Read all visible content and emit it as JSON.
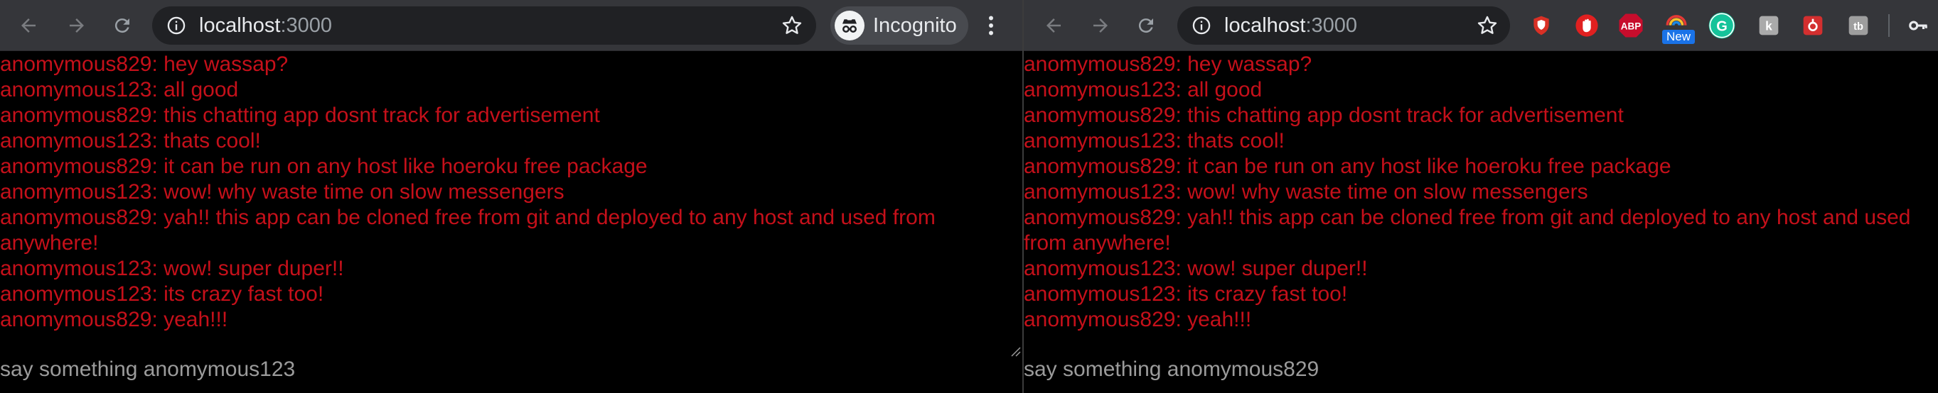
{
  "left_window": {
    "toolbar": {
      "url_host": "localhost",
      "url_port": ":3000",
      "profile_label": "Incognito"
    },
    "messages": [
      "anomymous829: hey wassap?",
      "anomymous123: all good",
      "anomymous829: this chatting app dosnt track for advertisement",
      "anomymous123: thats cool!",
      "anomymous829: it can be run on any host like hoeroku free package",
      "anomymous123: wow! why waste time on slow messengers",
      "anomymous829: yah!! this app can be cloned free from git and deployed to any host and used from anywhere!",
      "anomymous123: wow! super duper!!",
      "anomymous123: its crazy fast too!",
      "anomymous829: yeah!!!"
    ],
    "input_placeholder": "say something anomymous123"
  },
  "right_window": {
    "toolbar": {
      "url_host": "localhost",
      "url_port": ":3000",
      "extensions": [
        {
          "icon": "shield-extension-icon",
          "color": "#d93025"
        },
        {
          "icon": "stop-hand-extension-icon",
          "color": "#e02020"
        },
        {
          "icon": "adblock-plus-icon",
          "label": "ABP",
          "color": "#c70d2c"
        },
        {
          "icon": "rainbow-extension-icon",
          "badge": "New",
          "color": "#1a73e8"
        },
        {
          "icon": "grammarly-icon",
          "label": "G",
          "color": "#15c39a"
        },
        {
          "icon": "k-extension-icon",
          "label": "k",
          "color": "#aaaaaa"
        },
        {
          "icon": "red-extension-icon",
          "color": "#d32f2f"
        },
        {
          "icon": "tb-extension-icon",
          "label": "tb",
          "color": "#9e9e9e"
        },
        {
          "icon": "key-icon",
          "color": "#e8eaed"
        }
      ]
    },
    "messages": [
      "anomymous829: hey wassap?",
      "anomymous123: all good",
      "anomymous829: this chatting app dosnt track for advertisement",
      "anomymous123: thats cool!",
      "anomymous829: it can be run on any host like hoeroku free package",
      "anomymous123: wow! why waste time on slow messengers",
      "anomymous829: yah!! this app can be cloned free from git and deployed to any host and used from anywhere!",
      "anomymous123: wow! super duper!!",
      "anomymous123: its crazy fast too!",
      "anomymous829: yeah!!!"
    ],
    "input_placeholder": "say something anomymous829"
  },
  "colors": {
    "message_text": "#c5101a",
    "input_text": "#9b9b9b",
    "toolbar_bg": "#35363a",
    "omnibox_bg": "#202124"
  }
}
